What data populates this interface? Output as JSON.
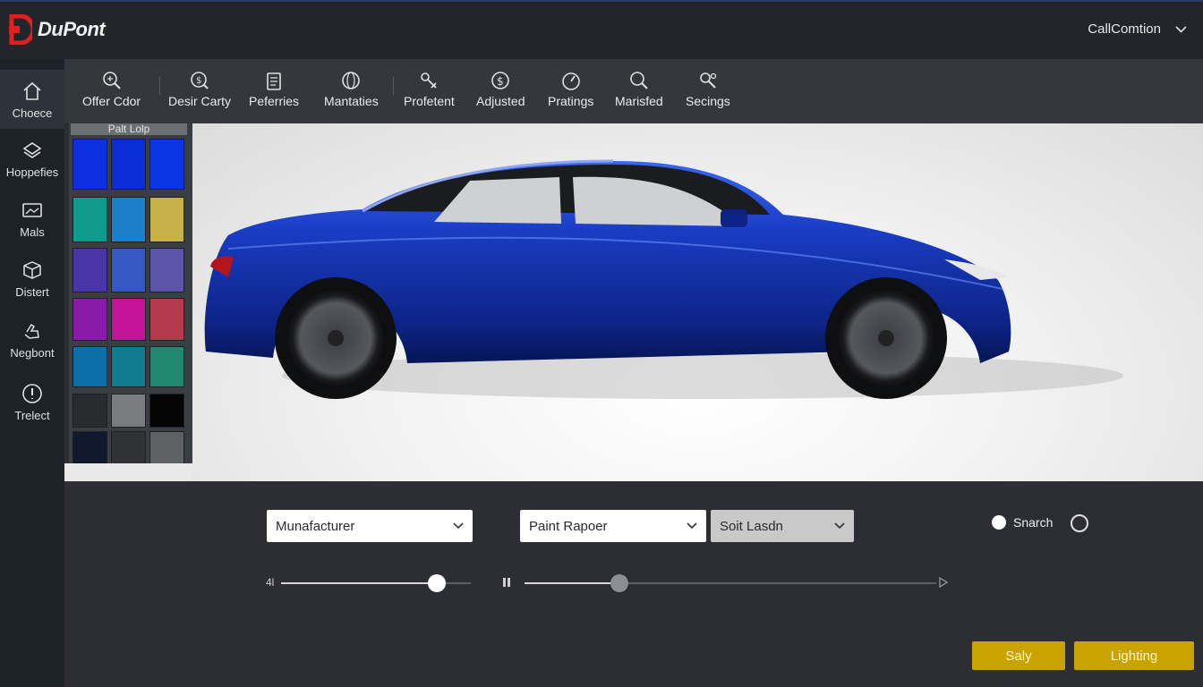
{
  "brand": {
    "name": "DuPont"
  },
  "account": {
    "name": "CallComtion"
  },
  "sidebar": {
    "items": [
      {
        "label": "Choece",
        "icon": "home-icon"
      },
      {
        "label": "Hoppefies",
        "icon": "stack-icon"
      },
      {
        "label": "Mals",
        "icon": "folder-image-icon"
      },
      {
        "label": "Distert",
        "icon": "box-icon"
      },
      {
        "label": "Negbont",
        "icon": "hand-icon"
      },
      {
        "label": "Trelect",
        "icon": "info-icon"
      }
    ]
  },
  "toolbar": {
    "items": [
      {
        "label": "Offer Cdor",
        "icon": "magnify-color-icon"
      },
      {
        "label": "Desir Carty",
        "icon": "search-dollar-icon"
      },
      {
        "label": "Peferries",
        "icon": "clipboard-icon"
      },
      {
        "label": "Mantaties",
        "icon": "sphere-icon"
      },
      {
        "label": "Profetent",
        "icon": "tools-icon"
      },
      {
        "label": "Adjusted",
        "icon": "dollar-circle-icon"
      },
      {
        "label": "Pratings",
        "icon": "gauge-icon"
      },
      {
        "label": "Marisfed",
        "icon": "search-icon"
      },
      {
        "label": "Secings",
        "icon": "settings-search-icon"
      }
    ]
  },
  "palette": {
    "title": "Palt Lolp",
    "swatches": [
      [
        "#0c2fe0",
        "#0a2fd8",
        "#0c35e6"
      ],
      [
        "#0f9a8e",
        "#1e7fc9",
        "#c7b24a"
      ],
      [
        "#4a35a8",
        "#3659c1",
        "#5a55a8"
      ],
      [
        "#8a1ba8",
        "#c4129b",
        "#b33a4a"
      ],
      [
        "#0d6fa8",
        "#107c8f",
        "#248770"
      ],
      [
        "#2a2b2d",
        "#7b7c7e",
        "#050505"
      ],
      [
        "#101a2c",
        "#303236",
        "#5f6063"
      ]
    ]
  },
  "controls": {
    "manufacturer": "Munafacturer",
    "paint_mapper": "Paint Rapoer",
    "finish": "Soit Lasdn",
    "radio_label": "Snarch",
    "slider1_label": "4l",
    "slider1_value": 0.82,
    "slider2_value": 0.23
  },
  "buttons": {
    "apply": "Saly",
    "lighting": "Lighting"
  },
  "colors": {
    "accent": "#c9a400",
    "car_blue": "#1a3cc4",
    "logo_red": "#e0201c"
  }
}
